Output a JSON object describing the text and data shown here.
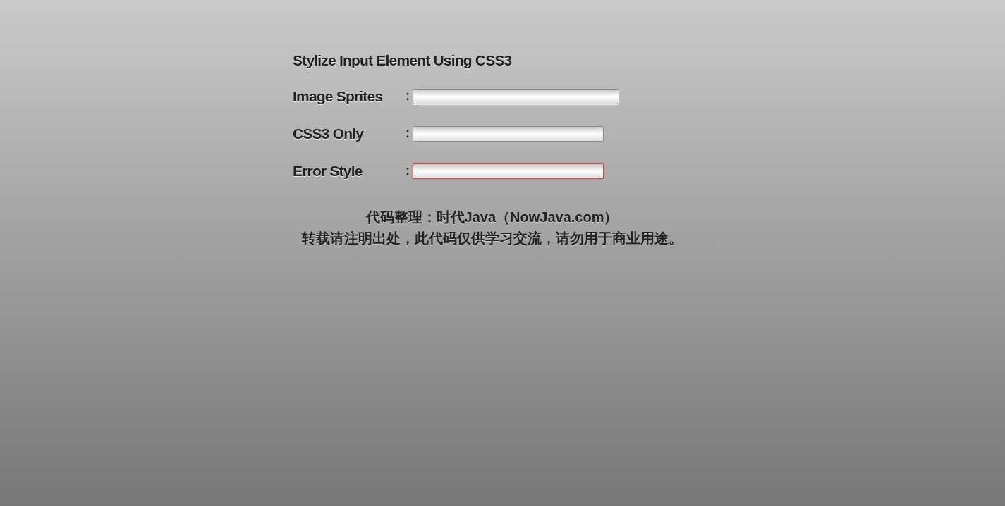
{
  "title": "Stylize Input Element Using CSS3",
  "fields": [
    {
      "label": "Image Sprites",
      "separator": ":",
      "kind": "sprite",
      "error": false
    },
    {
      "label": "CSS3 Only",
      "separator": ":",
      "kind": "css",
      "error": false
    },
    {
      "label": "Error Style",
      "separator": ":",
      "kind": "css",
      "error": true
    }
  ],
  "credits": [
    "代码整理：**时代Java**（NowJava.com）",
    "转载请注明出处，此代码仅供学习交流，请勿用于商业用途。"
  ]
}
